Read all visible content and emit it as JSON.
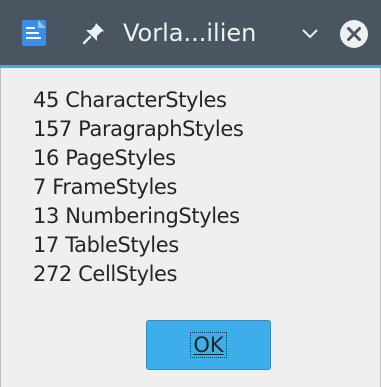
{
  "window": {
    "title": "Vorla...ilien",
    "app_icon": "document-icon",
    "pin_icon": "pin-icon",
    "menu_icon": "chevron-down-icon",
    "close_icon": "close-icon"
  },
  "stats": [
    "45 CharacterStyles",
    "157 ParagraphStyles",
    "16 PageStyles",
    "7 FrameStyles",
    "13 NumberingStyles",
    "17 TableStyles",
    "272 CellStyles"
  ],
  "ok_button": {
    "label": "OK"
  },
  "colors": {
    "titlebar": "#4a5562",
    "accent": "#3daee9",
    "background": "#efefef",
    "text": "#232629"
  }
}
